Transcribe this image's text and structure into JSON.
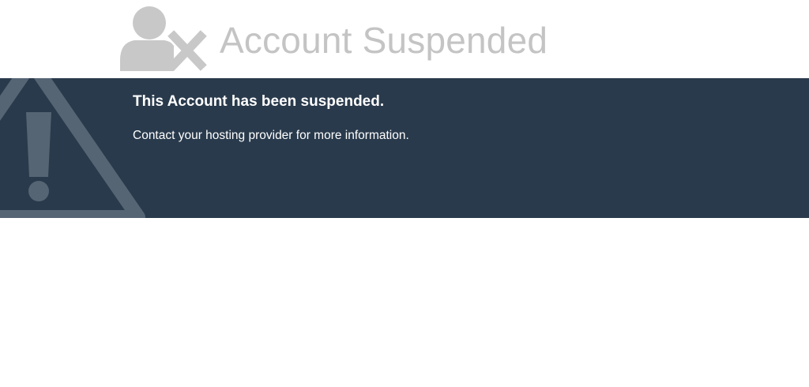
{
  "header": {
    "title": "Account Suspended",
    "icon": "user-x-icon"
  },
  "banner": {
    "heading": "This Account has been suspended.",
    "message": "Contact your hosting provider for more information.",
    "icon": "warning-icon"
  },
  "colors": {
    "banner_background": "#293a4c",
    "header_text": "#c4c4c4",
    "icon_gray": "#c8c8c8",
    "warning_icon": "#566574",
    "banner_text": "#ffffff"
  }
}
